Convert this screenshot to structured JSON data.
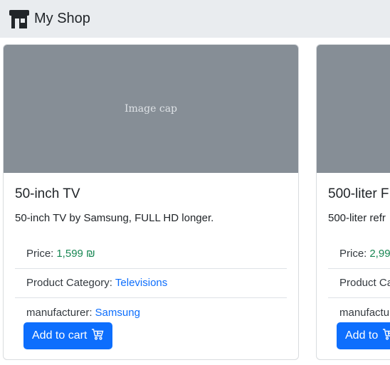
{
  "navbar": {
    "brand_icon": "shop-icon",
    "brand_label": "My Shop"
  },
  "products": [
    {
      "image_label": "Image cap",
      "title": "50-inch TV",
      "description": "50-inch TV by Samsung, FULL HD longer.",
      "price_label": "Price:",
      "price_value": "1,599 ₪",
      "category_label": "Product Category:",
      "category_value": "Televisions",
      "manufacturer_label": "manufacturer:",
      "manufacturer_value": "Samsung",
      "button_label": "Add to cart",
      "button_icon": "cart-icon"
    },
    {
      "image_label": "",
      "title": "500-liter F",
      "description": "500-liter refr",
      "price_label": "Price:",
      "price_value": "2,99",
      "category_label": "Product Ca",
      "category_value": "",
      "manufacturer_label": "manufactu",
      "manufacturer_value": "",
      "button_label": "Add to",
      "button_icon": "cart-icon"
    }
  ],
  "colors": {
    "navbar_bg": "#e9ecef",
    "image_placeholder": "#868e96",
    "primary": "#0d6efd",
    "price": "#198754"
  }
}
